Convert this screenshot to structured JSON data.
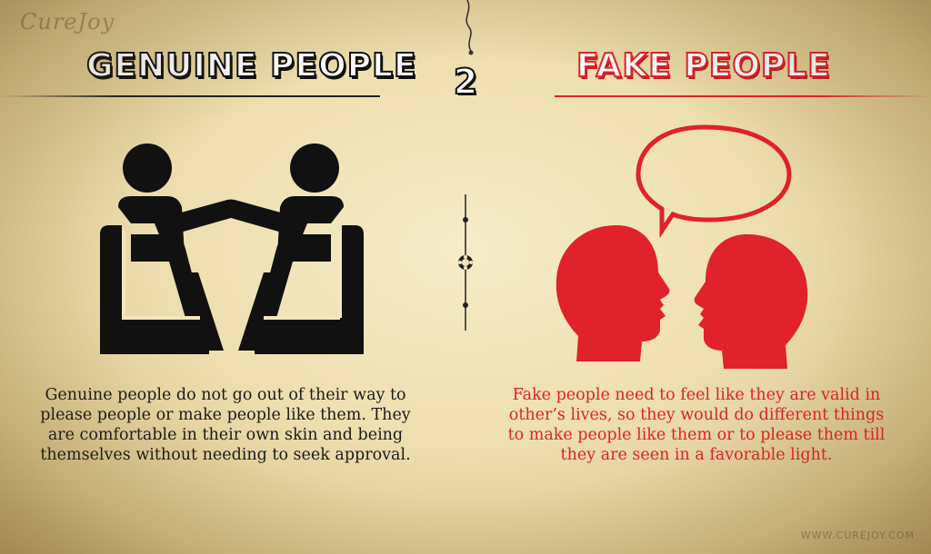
{
  "logo_text": "CureJoy",
  "step_number": "2",
  "left": {
    "heading": "GENUINE PEOPLE",
    "description": "Genuine people do not go out of their way to please people or make people like them. They are comfortable in their own skin and being themselves without needing to seek approval."
  },
  "right": {
    "heading": "FAKE PEOPLE",
    "description": "Fake people need to feel like they are valid in other’s lives, so they would do different things to make people like them or to please them till they are seen in a favorable light."
  },
  "watermark": "WWW.CUREJOY.COM",
  "icons": {
    "left": "two-people-sitting-talking-icon",
    "right": "two-heads-speech-bubble-icon",
    "divider": "ornamental-divider-icon"
  },
  "colors": {
    "accent_red": "#e0222a",
    "ink": "#111111",
    "parchment": "#f2e6bd"
  }
}
